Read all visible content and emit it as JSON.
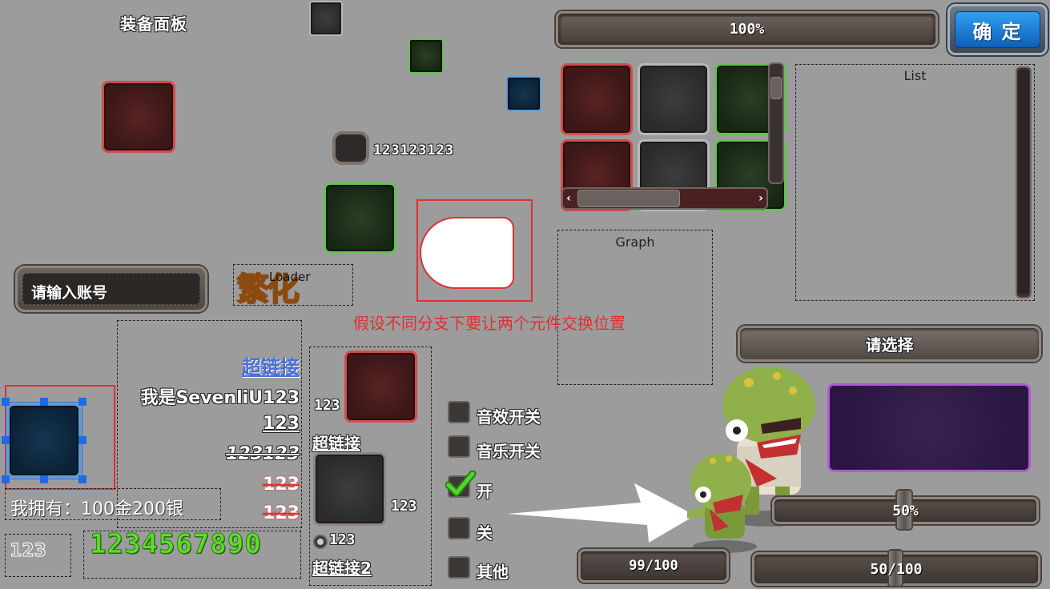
{
  "panel_title": "装备面板",
  "progress_top": {
    "label": "100%",
    "value": 1.0
  },
  "confirm_button": "确 定",
  "list_title": "List",
  "graph_title": "Graph",
  "loader_title": "Loader",
  "loader_image_text": "繁化",
  "account_input": {
    "placeholder": "请输入账号"
  },
  "small_slot_text": "123123123",
  "note_text": "假设不同分支下要让两个元件交换位置",
  "select_button": "请选择",
  "rich_text": {
    "link": "超链接",
    "line1": "我是SevenliU123",
    "line2": "123",
    "line3": "123123",
    "line4": "123",
    "line5": "123"
  },
  "owned_text": "我拥有：100金200银",
  "small_number": "123",
  "big_number": "1234567890",
  "middle_column": {
    "slot_label": "123",
    "link1": "超链接",
    "slot2_label": "123",
    "radio_label": "123",
    "link2": "超链接2"
  },
  "checkboxes": [
    {
      "label": "音效开关",
      "checked": false
    },
    {
      "label": "音乐开关",
      "checked": false
    },
    {
      "label": "开",
      "checked": true
    },
    {
      "label": "关",
      "checked": false
    },
    {
      "label": "其他",
      "checked": false
    }
  ],
  "slider_percent": {
    "label": "50%",
    "value": 0.5
  },
  "hp_bar": {
    "label": "99/100",
    "value": 0.99
  },
  "mp_bar": {
    "label": "50/100",
    "value": 0.5
  },
  "colors": {
    "background": "#9c9c9c",
    "slot_red": "#d24c4c",
    "slot_green": "#63c251",
    "slot_blue": "#5a9dd8",
    "link_blue": "#4a6fd8",
    "note_red": "#e03030",
    "number_green": "#5ae028",
    "purple_panel": "#b05ad8"
  },
  "icons": [
    "checkmark-icon",
    "zombie-character",
    "arrow-pointer",
    "scroll-left-icon",
    "scroll-right-icon"
  ]
}
